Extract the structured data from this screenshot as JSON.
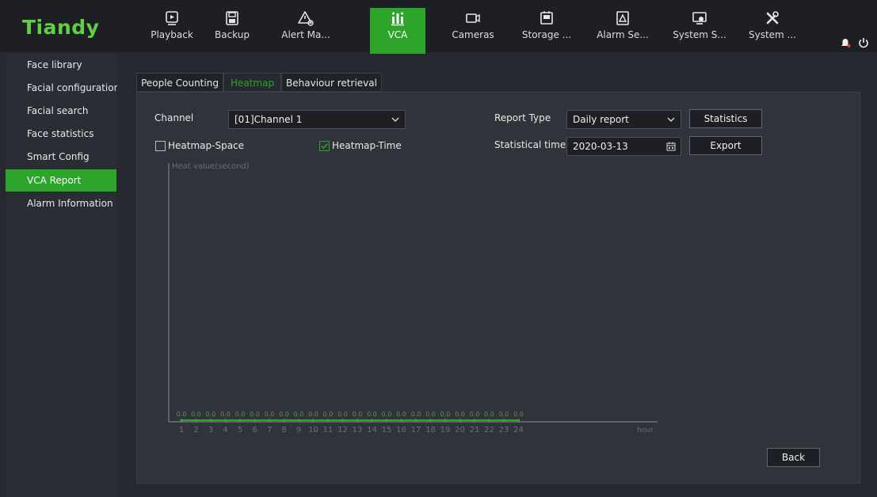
{
  "brand": {
    "logo": "Tiandy",
    "accent": "#2ca52a",
    "logo_color": "#5fd142"
  },
  "nav": [
    {
      "label": "Playback",
      "icon": "playback-icon"
    },
    {
      "label": "Backup",
      "icon": "floppy-icon"
    },
    {
      "label": "Alert Ma...",
      "icon": "alert-icon"
    },
    {
      "label": "VCA",
      "icon": "vca-icon",
      "active": true
    },
    {
      "label": "Cameras",
      "icon": "camera-icon"
    },
    {
      "label": "Storage ...",
      "icon": "storage-icon"
    },
    {
      "label": "Alarm Se...",
      "icon": "alarm-settings-icon"
    },
    {
      "label": "System S...",
      "icon": "system-settings-icon"
    },
    {
      "label": "System ...",
      "icon": "wrench-icon"
    }
  ],
  "sidebar": [
    {
      "label": "Face library"
    },
    {
      "label": "Facial configuration"
    },
    {
      "label": "Facial search"
    },
    {
      "label": "Face statistics"
    },
    {
      "label": "Smart Config"
    },
    {
      "label": "VCA Report",
      "active": true
    },
    {
      "label": "Alarm Information"
    }
  ],
  "tabs": [
    {
      "label": "People Counting"
    },
    {
      "label": "Heatmap",
      "active": true
    },
    {
      "label": "Behaviour retrieval"
    }
  ],
  "form": {
    "channel_label": "Channel",
    "channel_value": "[01]Channel 1",
    "report_type_label": "Report Type",
    "report_type_value": "Daily report",
    "statistics_button": "Statistics",
    "stat_time_label": "Statistical time",
    "stat_time_value": "2020-03-13",
    "export_button": "Export",
    "heatmap_space_label": "Heatmap-Space",
    "heatmap_space_checked": false,
    "heatmap_time_label": "Heatmap-Time",
    "heatmap_time_checked": true,
    "back_button": "Back"
  },
  "chart_data": {
    "type": "line",
    "ylabel": "Heat value(second)",
    "xlabel": "hour",
    "x": [
      1,
      2,
      3,
      4,
      5,
      6,
      7,
      8,
      9,
      10,
      11,
      12,
      13,
      14,
      15,
      16,
      17,
      18,
      19,
      20,
      21,
      22,
      23,
      24
    ],
    "values": [
      0,
      0,
      0,
      0,
      0,
      0,
      0,
      0,
      0,
      0,
      0,
      0,
      0,
      0,
      0,
      0,
      0,
      0,
      0,
      0,
      0,
      0,
      0,
      0
    ],
    "value_labels": [
      "0.0",
      "0.0",
      "0.0",
      "0.0",
      "0.0",
      "0.0",
      "0.0",
      "0.0",
      "0.0",
      "0.0",
      "0.0",
      "0.0",
      "0.0",
      "0.0",
      "0.0",
      "0.0",
      "0.0",
      "0.0",
      "0.0",
      "0.0",
      "0.0",
      "0.0",
      "0.0",
      "0.0"
    ],
    "line_color": "#2ca52a",
    "grid": false
  }
}
